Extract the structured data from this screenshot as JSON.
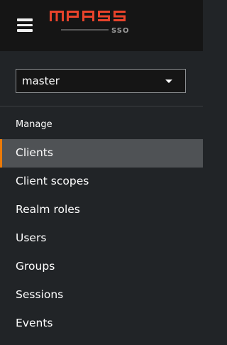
{
  "header": {
    "menu_icon": "hamburger-icon",
    "logo": {
      "wordmark": "MPASS",
      "subtext": "SSO",
      "color": "#e8432b"
    }
  },
  "realm_selector": {
    "value": "master",
    "icon": "caret-down-icon"
  },
  "sidebar": {
    "section_title": "Manage",
    "accent_color": "#ec7a08",
    "items": [
      {
        "label": "Clients",
        "active": true
      },
      {
        "label": "Client scopes"
      },
      {
        "label": "Realm roles"
      },
      {
        "label": "Users"
      },
      {
        "label": "Groups"
      },
      {
        "label": "Sessions"
      },
      {
        "label": "Events"
      }
    ]
  }
}
